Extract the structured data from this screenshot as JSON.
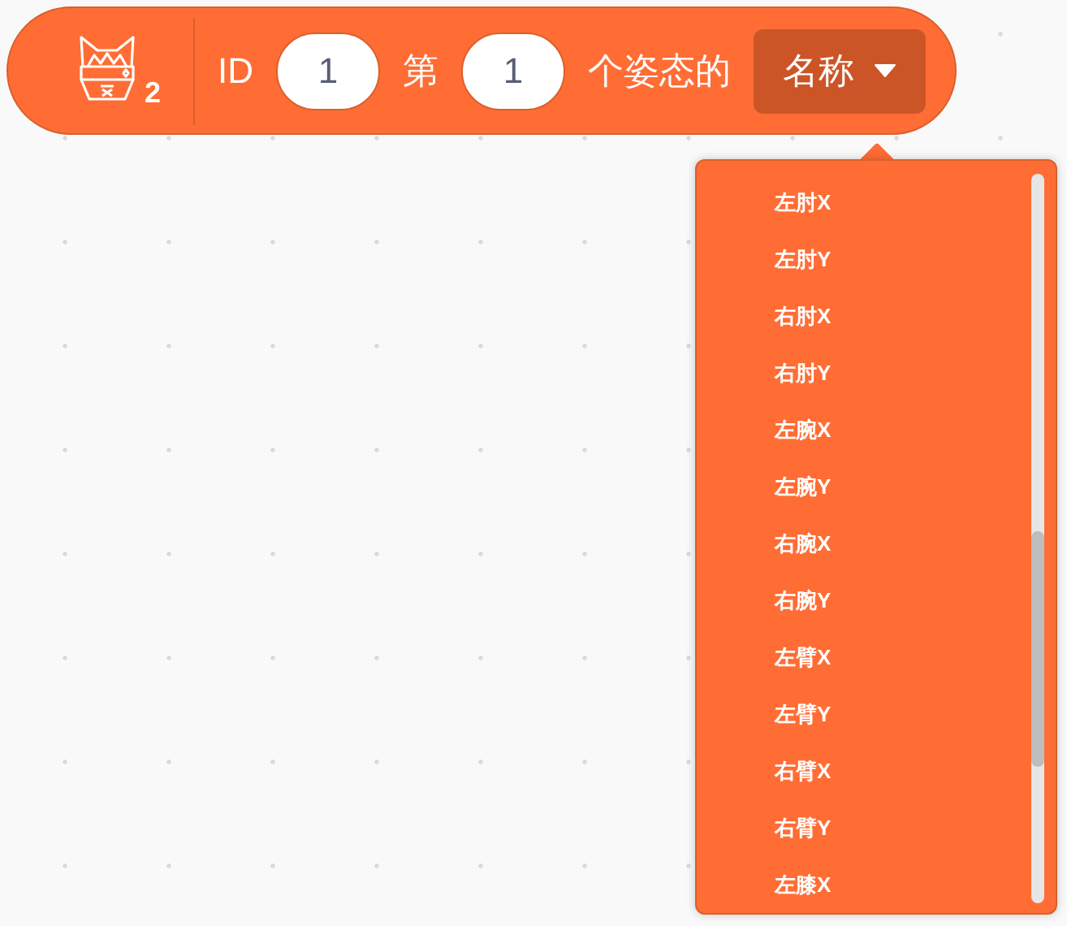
{
  "block": {
    "badge": "2",
    "segments": [
      {
        "kind": "label",
        "text": "ID"
      },
      {
        "kind": "input",
        "value": "1"
      },
      {
        "kind": "label",
        "text": "第"
      },
      {
        "kind": "input",
        "value": "1"
      },
      {
        "kind": "label",
        "text": "个姿态的"
      },
      {
        "kind": "dropdown",
        "value": "名称"
      }
    ]
  },
  "menu": {
    "items": [
      "左肘X",
      "左肘Y",
      "右肘X",
      "右肘Y",
      "左腕X",
      "左腕Y",
      "右腕X",
      "右腕Y",
      "左臂X",
      "左臂Y",
      "右臂X",
      "右臂Y",
      "左膝X"
    ]
  }
}
